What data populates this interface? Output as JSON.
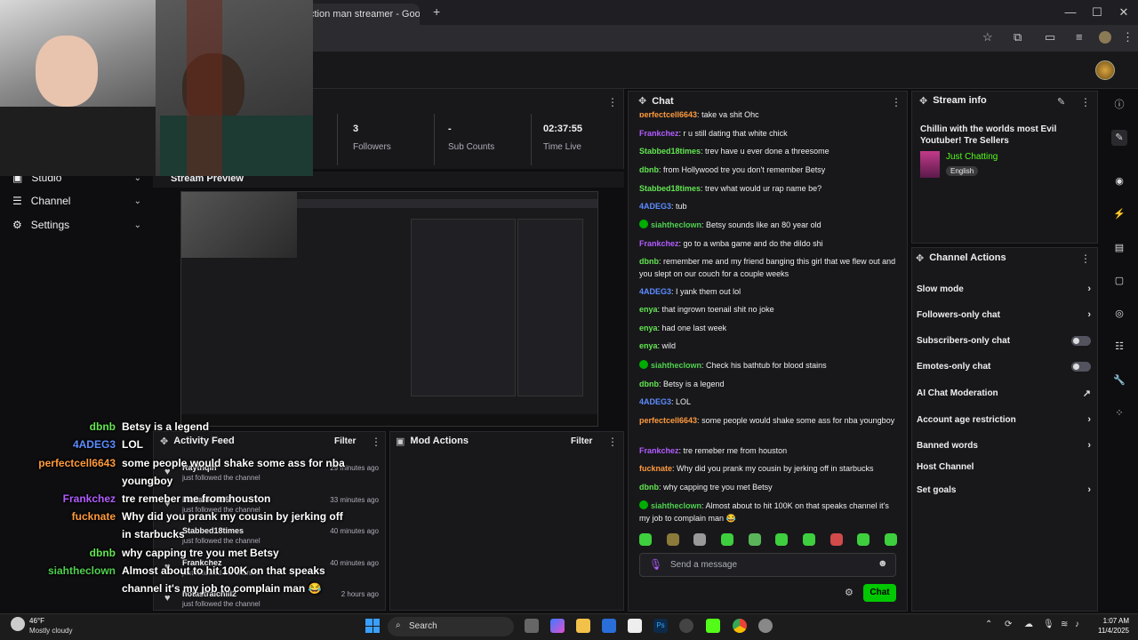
{
  "browser": {
    "tab_title": "ction man streamer - Google",
    "new_tab": "+",
    "controls": [
      "—",
      "☐",
      "✕"
    ]
  },
  "stats": {
    "followers_value": "3",
    "followers_label": "Followers",
    "subs_value": "-",
    "subs_label": "Sub Counts",
    "time_value": "02:37:55",
    "time_label": "Time Live"
  },
  "nav": {
    "studio": "Studio",
    "channel": "Channel",
    "settings": "Settings"
  },
  "preview": {
    "title": "Stream Preview"
  },
  "chat": {
    "title": "Chat",
    "messages": [
      {
        "name": "perfectcell6643",
        "text": "take ya shit Ohc",
        "color": "#ff9a3c"
      },
      {
        "name": "Frankchez",
        "text": "r u still dating that white chick",
        "color": "#b25cff"
      },
      {
        "name": "Stabbed18times",
        "text": "trev have u ever done a threesome",
        "color": "#63e651"
      },
      {
        "name": "dbnb",
        "text": "from Hollywood tre you don't remember Betsy",
        "color": "#63e651"
      },
      {
        "name": "Stabbed18times",
        "text": "trev what would ur rap name be?",
        "color": "#63e651"
      },
      {
        "name": "4ADEG3",
        "text": "tub",
        "color": "#5c8cff"
      },
      {
        "name": "siahtheclown",
        "text": "Betsy sounds like an 80 year old",
        "color": "#4fd14f"
      },
      {
        "name": "Frankchez",
        "text": "go to a wnba game and do the dildo shi",
        "color": "#b25cff"
      },
      {
        "name": "dbnb",
        "text": "remember me and my friend banging this girl that we flew out and you slept on our couch for a couple weeks",
        "color": "#63e651"
      },
      {
        "name": "4ADEG3",
        "text": "I yank them out lol",
        "color": "#5c8cff"
      },
      {
        "name": "enya",
        "text": "that ingrown toenail shit no joke",
        "color": "#63e651"
      },
      {
        "name": "enya",
        "text": "had one last week",
        "color": "#63e651"
      },
      {
        "name": "enya",
        "text": "wild",
        "color": "#63e651"
      },
      {
        "name": "siahtheclown",
        "text": "Check his bathtub for blood stains",
        "color": "#4fd14f"
      },
      {
        "name": "dbnb",
        "text": "Betsy is a legend",
        "color": "#63e651"
      },
      {
        "name": "4ADEG3",
        "text": "LOL",
        "color": "#5c8cff"
      },
      {
        "name": "perfectcell6643",
        "text": "some people would shake some ass for nba youngboy",
        "color": "#ff9a3c"
      },
      {
        "name": "Frankchez",
        "text": "tre remeber me from houston",
        "color": "#b25cff"
      },
      {
        "name": "fucknate",
        "text": "Why did you prank my cousin by jerking off in starbucks",
        "color": "#ff9a3c"
      },
      {
        "name": "dbnb",
        "text": "why capping tre you met Betsy",
        "color": "#63e651"
      },
      {
        "name": "siahtheclown",
        "text": "Almost about to hit 100K on that speaks channel it's my job to complain man 😂",
        "color": "#4fd14f"
      }
    ],
    "input_placeholder": "Send a message",
    "send_label": "Chat"
  },
  "stream_info": {
    "title": "Stream info",
    "stream_title": "Chillin with the worlds most Evil Youtuber! Tre Sellers",
    "category": "Just Chatting",
    "language": "English"
  },
  "channel_actions": {
    "title": "Channel Actions",
    "items": [
      {
        "label": "Slow mode",
        "control": "arrow"
      },
      {
        "label": "Followers-only chat",
        "control": "arrow"
      },
      {
        "label": "Subscribers-only chat",
        "control": "toggle"
      },
      {
        "label": "Emotes-only chat",
        "control": "toggle"
      },
      {
        "label": "AI Chat Moderation",
        "control": "external"
      },
      {
        "label": "Account age restriction",
        "control": "arrow"
      },
      {
        "label": "Banned words",
        "control": "arrow"
      },
      {
        "label": "Host Channel",
        "control": "none"
      },
      {
        "label": "Set goals",
        "control": "arrow"
      }
    ]
  },
  "activity": {
    "title": "Activity Feed",
    "filter": "Filter",
    "items": [
      {
        "name": "Raythqlh",
        "sub": "just followed the channel",
        "time": "29 minutes ago"
      },
      {
        "name": "Manakk7896",
        "sub": "just followed the channel",
        "time": "33 minutes ago"
      },
      {
        "name": "Stabbed18times",
        "sub": "just followed the channel",
        "time": "40 minutes ago"
      },
      {
        "name": "Frankchez",
        "sub": "just followed the channel",
        "time": "40 minutes ago"
      },
      {
        "name": "hotastralchill2",
        "sub": "just followed the channel",
        "time": "2 hours ago"
      }
    ]
  },
  "mod_actions": {
    "title": "Mod Actions",
    "filter": "Filter"
  },
  "overlay_chat": [
    {
      "name": "dbnb",
      "text": "Betsy is a legend",
      "color": "#63e651"
    },
    {
      "name": "4ADEG3",
      "text": "LOL",
      "color": "#5c8cff"
    },
    {
      "name": "perfectcell6643",
      "text": "some people would shake some ass for nba youngboy",
      "color": "#ff9a3c"
    },
    {
      "name": "Frankchez",
      "text": "tre remeber me from houston",
      "color": "#b25cff"
    },
    {
      "name": "fucknate",
      "text": "Why did you prank my cousin by jerking off in starbucks",
      "color": "#ff9a3c"
    },
    {
      "name": "dbnb",
      "text": "why capping tre you met Betsy",
      "color": "#63e651"
    },
    {
      "name": "siahtheclown",
      "text": "Almost about to hit 100K on that speaks channel it's my job to complain man 😂",
      "color": "#4fd14f"
    }
  ],
  "taskbar": {
    "weather_temp": "46°F",
    "weather_desc": "Mostly cloudy",
    "search": "Search",
    "time": "1:07 AM",
    "date": "11/4/2025"
  }
}
